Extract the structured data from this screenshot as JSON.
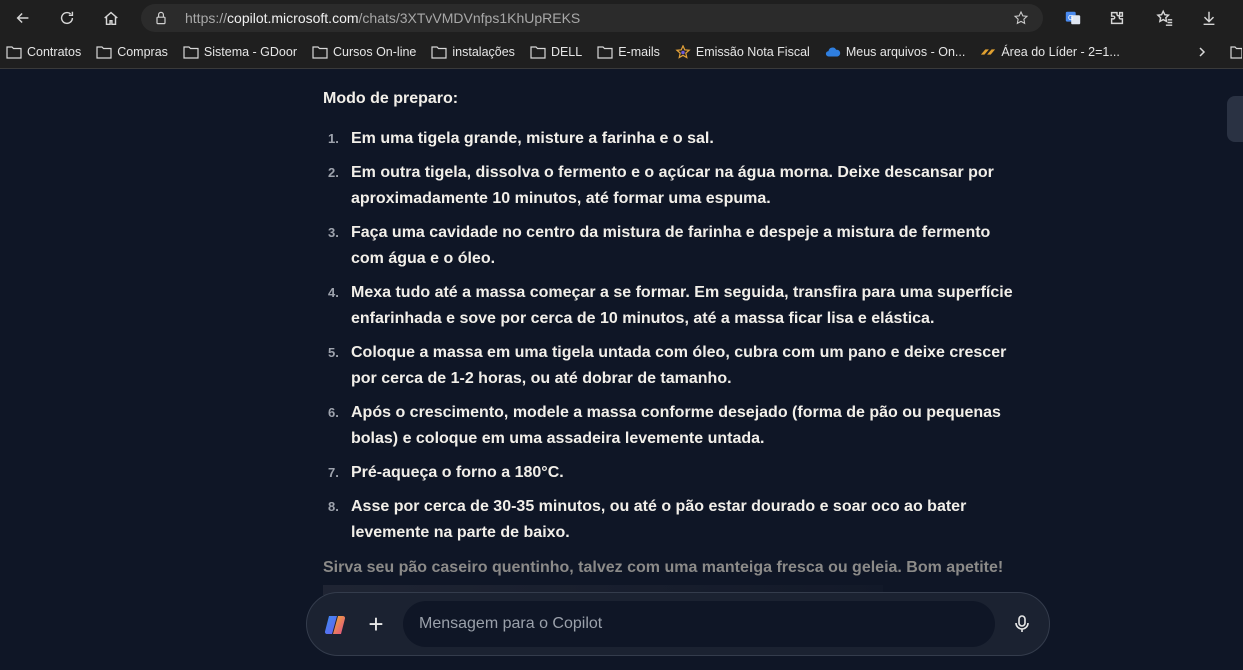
{
  "browser": {
    "url_prefix": "https://",
    "url_host": "copilot.microsoft.com",
    "url_path": "/chats/3XTvVMDVnfps1KhUpREKS"
  },
  "bookmarks": [
    {
      "label": "Contratos",
      "icon": "folder-icon"
    },
    {
      "label": "Compras",
      "icon": "folder-icon"
    },
    {
      "label": "Sistema - GDoor",
      "icon": "folder-icon"
    },
    {
      "label": "Cursos On-line",
      "icon": "folder-icon"
    },
    {
      "label": "instalações",
      "icon": "folder-icon"
    },
    {
      "label": "DELL",
      "icon": "folder-icon"
    },
    {
      "label": "E-mails",
      "icon": "folder-icon"
    },
    {
      "label": "Emissão Nota Fiscal",
      "icon": "star-logo-icon"
    },
    {
      "label": "Meus arquivos - On...",
      "icon": "onedrive-icon"
    },
    {
      "label": "Área do Líder - 2=1...",
      "icon": "brand-icon"
    }
  ],
  "chat": {
    "heading": "Modo de preparo:",
    "steps": [
      {
        "num": "1.",
        "lines": [
          "Em uma tigela grande, misture a farinha e o sal."
        ]
      },
      {
        "num": "2.",
        "lines": [
          "Em outra tigela, dissolva o fermento e o açúcar na água morna. Deixe descansar por",
          "aproximadamente 10 minutos, até formar uma espuma."
        ]
      },
      {
        "num": "3.",
        "lines": [
          "Faça uma cavidade no centro da mistura de farinha e despeje a mistura de fermento",
          "com água e o óleo."
        ]
      },
      {
        "num": "4.",
        "lines": [
          "Mexa tudo até a massa começar a se formar. Em seguida, transfira para uma superfície",
          "enfarinhada e sove por cerca de 10 minutos, até a massa ficar lisa e elástica."
        ]
      },
      {
        "num": "5.",
        "lines": [
          "Coloque a massa em uma tigela untada com óleo, cubra com um pano e deixe crescer",
          "por cerca de 1-2 horas, ou até dobrar de tamanho."
        ]
      },
      {
        "num": "6.",
        "lines": [
          "Após o crescimento, modele a massa conforme desejado (forma de pão ou pequenas",
          "bolas) e coloque em uma assadeira levemente untada."
        ]
      },
      {
        "num": "7.",
        "lines": [
          "Pré-aqueça o forno a 180°C."
        ]
      },
      {
        "num": "8.",
        "lines": [
          "Asse por cerca de 30-35 minutos, ou até o pão estar dourado e soar oco ao bater",
          "levemente na parte de baixo."
        ]
      }
    ],
    "closing": "Sirva seu pão caseiro quentinho, talvez com uma manteiga fresca ou geleia. Bom apetite!"
  },
  "composer": {
    "placeholder": "Mensagem para o Copilot"
  }
}
